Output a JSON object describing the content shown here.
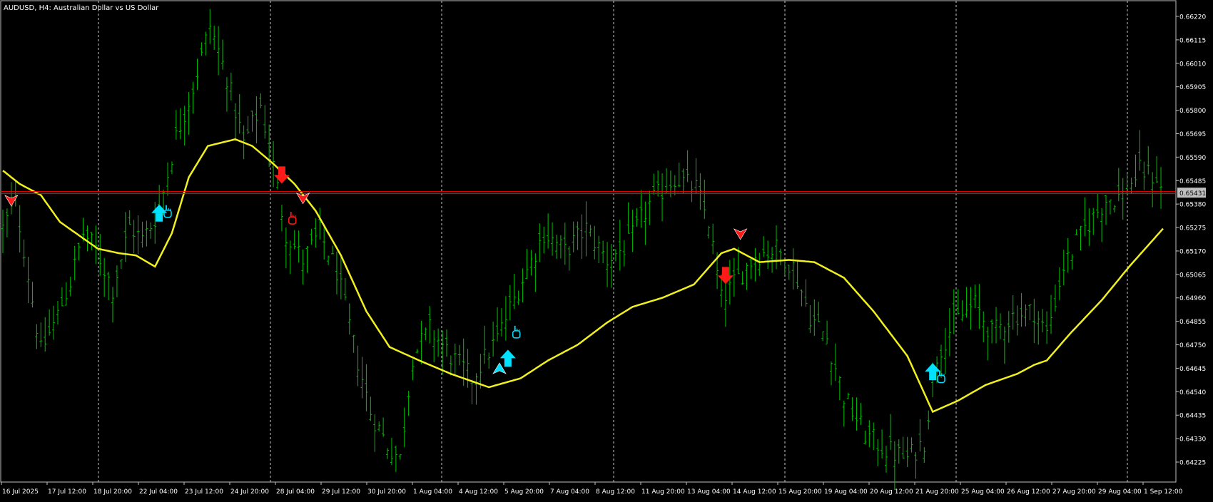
{
  "window": {
    "title": "AUDUSD, H4:  Australian Dollar vs US Dollar",
    "bid_label": "0.65431"
  },
  "colors": {
    "background": "#000000",
    "frame": "#c0c0c0",
    "candle": "#00c000",
    "moving_average": "#f0f020",
    "bid_line": "#ff0000",
    "buy_arrow": "#00e0ff",
    "sell_arrow": "#ff1a1a",
    "grid": "#c8c8c8",
    "price_tag_bg": "#c0c0c0",
    "price_tag_text": "#000000"
  },
  "icons": {
    "buy": "up-arrow-icon",
    "sell": "down-arrow-icon",
    "hand": "hand-pointer-icon",
    "pointer": "arrow-pointer-icon"
  },
  "chart_data": {
    "type": "bar",
    "symbol": "AUDUSD",
    "timeframe": "H4",
    "ylim": [
      0.6416,
      0.6629
    ],
    "y_ticks": [
      "0.66220",
      "0.66115",
      "0.66010",
      "0.65905",
      "0.65800",
      "0.65695",
      "0.65590",
      "0.65485",
      "0.65380",
      "0.65275",
      "0.65170",
      "0.65065",
      "0.64960",
      "0.64855",
      "0.64750",
      "0.64645",
      "0.64540",
      "0.64435",
      "0.64330",
      "0.64225"
    ],
    "x_ticks": [
      "16 Jul 2025",
      "17 Jul 12:00",
      "18 Jul 20:00",
      "22 Jul 04:00",
      "23 Jul 12:00",
      "24 Jul 20:00",
      "28 Jul 04:00",
      "29 Jul 12:00",
      "30 Jul 20:00",
      "1 Aug 04:00",
      "4 Aug 12:00",
      "5 Aug 20:00",
      "7 Aug 04:00",
      "8 Aug 12:00",
      "11 Aug 20:00",
      "13 Aug 04:00",
      "14 Aug 12:00",
      "15 Aug 20:00",
      "19 Aug 04:00",
      "20 Aug 12:00",
      "21 Aug 20:00",
      "25 Aug 04:00",
      "26 Aug 12:00",
      "27 Aug 20:00",
      "29 Aug 04:00",
      "1 Sep 12:00"
    ],
    "period_separators": [
      0.5,
      10.5,
      20.5,
      30.5,
      40.5,
      50.5,
      60.5,
      70.5,
      80.5,
      90.5,
      100.5,
      110.5,
      120.5,
      130.5,
      140.5,
      150.5,
      160.5,
      170.5,
      180.5,
      190.5,
      200.5,
      210.5,
      220.5,
      230.5,
      240.5,
      250.5
    ],
    "bid": 0.65431,
    "ma_points": [
      [
        0.6553,
        0
      ],
      [
        0.6547,
        8
      ],
      [
        0.6542,
        18
      ],
      [
        0.653,
        27
      ],
      [
        0.6518,
        45
      ],
      [
        0.6516,
        55
      ],
      [
        0.6515,
        63
      ],
      [
        0.651,
        72
      ],
      [
        0.6525,
        80
      ],
      [
        0.655,
        88
      ],
      [
        0.6564,
        97
      ],
      [
        0.6567,
        110
      ],
      [
        0.6564,
        118
      ],
      [
        0.6556,
        128
      ],
      [
        0.6547,
        138
      ],
      [
        0.6535,
        148
      ],
      [
        0.6515,
        160
      ],
      [
        0.649,
        172
      ],
      [
        0.6474,
        183
      ],
      [
        0.6468,
        197
      ],
      [
        0.6462,
        212
      ],
      [
        0.6456,
        230
      ],
      [
        0.646,
        245
      ],
      [
        0.6468,
        258
      ],
      [
        0.6475,
        272
      ],
      [
        0.6485,
        286
      ],
      [
        0.6492,
        298
      ],
      [
        0.6496,
        312
      ],
      [
        0.6502,
        327
      ],
      [
        0.6516,
        340
      ],
      [
        0.6518,
        346
      ],
      [
        0.6512,
        358
      ],
      [
        0.6513,
        372
      ],
      [
        0.6512,
        384
      ],
      [
        0.6505,
        398
      ],
      [
        0.649,
        412
      ],
      [
        0.647,
        428
      ],
      [
        0.6445,
        440
      ],
      [
        0.645,
        452
      ],
      [
        0.6457,
        465
      ],
      [
        0.6462,
        480
      ],
      [
        0.6466,
        488
      ],
      [
        0.6468,
        494
      ],
      [
        0.648,
        505
      ],
      [
        0.6495,
        520
      ],
      [
        0.651,
        533
      ],
      [
        0.6527,
        549
      ]
    ],
    "price_path": [
      [
        0.6527,
        0
      ],
      [
        0.6539,
        6
      ],
      [
        0.6518,
        10
      ],
      [
        0.6472,
        18
      ],
      [
        0.6486,
        25
      ],
      [
        0.6503,
        32
      ],
      [
        0.6525,
        38
      ],
      [
        0.6518,
        44
      ],
      [
        0.65,
        52
      ],
      [
        0.6528,
        60
      ],
      [
        0.6522,
        66
      ],
      [
        0.6535,
        74
      ],
      [
        0.6568,
        82
      ],
      [
        0.659,
        90
      ],
      [
        0.6618,
        98
      ],
      [
        0.6595,
        106
      ],
      [
        0.6565,
        114
      ],
      [
        0.6582,
        122
      ],
      [
        0.6555,
        128
      ],
      [
        0.6525,
        134
      ],
      [
        0.6513,
        142
      ],
      [
        0.6525,
        150
      ],
      [
        0.6508,
        158
      ],
      [
        0.6475,
        166
      ],
      [
        0.6445,
        174
      ],
      [
        0.643,
        182
      ],
      [
        0.6424,
        188
      ],
      [
        0.647,
        194
      ],
      [
        0.6482,
        202
      ],
      [
        0.647,
        212
      ],
      [
        0.646,
        222
      ],
      [
        0.6478,
        234
      ],
      [
        0.65,
        244
      ],
      [
        0.6525,
        256
      ],
      [
        0.6517,
        266
      ],
      [
        0.6527,
        276
      ],
      [
        0.6513,
        286
      ],
      [
        0.652,
        296
      ],
      [
        0.6538,
        306
      ],
      [
        0.655,
        318
      ],
      [
        0.6545,
        328
      ],
      [
        0.653,
        334
      ],
      [
        0.6495,
        340
      ],
      [
        0.6505,
        348
      ],
      [
        0.6515,
        356
      ],
      [
        0.6518,
        366
      ],
      [
        0.651,
        374
      ],
      [
        0.6488,
        382
      ],
      [
        0.6478,
        390
      ],
      [
        0.6452,
        398
      ],
      [
        0.6435,
        408
      ],
      [
        0.6428,
        418
      ],
      [
        0.6424,
        428
      ],
      [
        0.6432,
        436
      ],
      [
        0.647,
        442
      ],
      [
        0.6485,
        450
      ],
      [
        0.6493,
        460
      ],
      [
        0.648,
        468
      ],
      [
        0.6488,
        478
      ],
      [
        0.649,
        488
      ],
      [
        0.648,
        494
      ],
      [
        0.651,
        502
      ],
      [
        0.6527,
        512
      ],
      [
        0.654,
        522
      ],
      [
        0.6542,
        530
      ],
      [
        0.6553,
        538
      ],
      [
        0.655,
        546
      ],
      [
        0.6542,
        549
      ]
    ],
    "signals": [
      {
        "type": "sell",
        "marker": "pointer",
        "x": 4,
        "price": 0.654
      },
      {
        "type": "buy",
        "marker": "arrow",
        "x": 74,
        "price": 0.6534
      },
      {
        "type": "buy",
        "marker": "hand",
        "x": 78,
        "price": 0.6534
      },
      {
        "type": "sell",
        "marker": "arrow",
        "x": 132,
        "price": 0.6551
      },
      {
        "type": "sell",
        "marker": "pointer",
        "x": 142,
        "price": 0.6541
      },
      {
        "type": "sell",
        "marker": "hand",
        "x": 137,
        "price": 0.6531
      },
      {
        "type": "buy",
        "marker": "pointer",
        "x": 235,
        "price": 0.6464
      },
      {
        "type": "buy",
        "marker": "arrow",
        "x": 239,
        "price": 0.6469
      },
      {
        "type": "buy",
        "marker": "hand",
        "x": 243,
        "price": 0.648
      },
      {
        "type": "sell",
        "marker": "pointer",
        "x": 349,
        "price": 0.6525
      },
      {
        "type": "sell",
        "marker": "arrow",
        "x": 342,
        "price": 0.6506
      },
      {
        "type": "buy",
        "marker": "arrow",
        "x": 440,
        "price": 0.6463
      },
      {
        "type": "buy",
        "marker": "hand",
        "x": 444,
        "price": 0.646
      }
    ]
  }
}
